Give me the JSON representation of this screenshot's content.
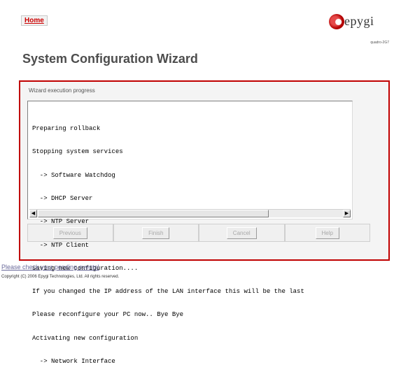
{
  "header": {
    "home_link": "Home",
    "logo_text": "epygi",
    "model": "quadro-2G7"
  },
  "page_title": "System Configuration Wizard",
  "panel": {
    "progress_label": "Wizard execution progress",
    "log_lines": [
      "Preparing rollback",
      "Stopping system services",
      "  -> Software Watchdog",
      "  -> DHCP Server",
      "  -> NTP Server",
      "  -> NTP Client",
      "Saving new configuration....",
      "If you changed the IP address of the LAN interface this will be the last",
      "Please reconfigure your PC now.. Bye Bye",
      "Activating new configuration",
      "  -> Network Interface"
    ],
    "scroll_left": "◀",
    "scroll_right": "▶"
  },
  "buttons": {
    "previous": "Previous",
    "finish": "Finish",
    "cancel": "Cancel",
    "help": "Help"
  },
  "footer": {
    "pending_events": "Please check your pending events!",
    "copyright": "Copyright (C) 2006 Epygi Technologies, Ltd. All rights reserved."
  },
  "colors": {
    "accent": "#c00000",
    "title": "#4d4d4d"
  }
}
